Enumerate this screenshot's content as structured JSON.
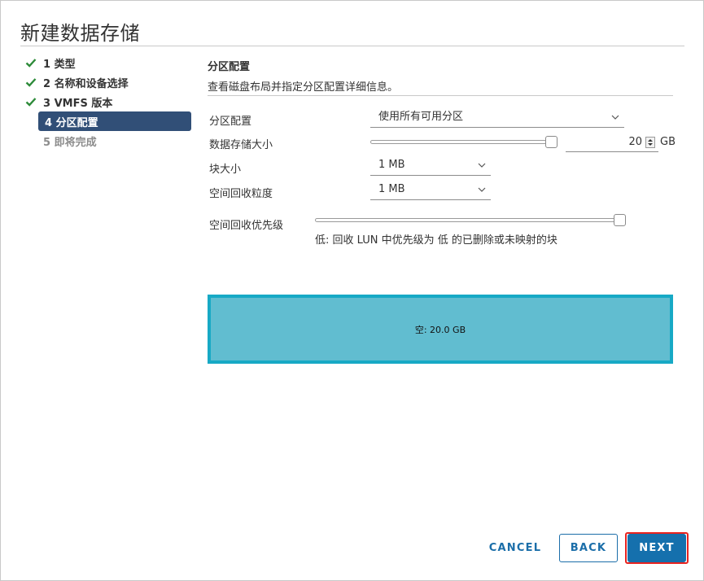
{
  "dialog": {
    "title": "新建数据存储"
  },
  "steps": [
    {
      "label": "1 类型",
      "state": "done"
    },
    {
      "label": "2 名称和设备选择",
      "state": "done"
    },
    {
      "label": "3 VMFS 版本",
      "state": "done"
    },
    {
      "label": "4 分区配置",
      "state": "active"
    },
    {
      "label": "5 即将完成",
      "state": "pending"
    }
  ],
  "section": {
    "title": "分区配置",
    "description": "查看磁盘布局并指定分区配置详细信息。"
  },
  "form": {
    "partition_config": {
      "label": "分区配置",
      "value": "使用所有可用分区"
    },
    "datastore_size": {
      "label": "数据存储大小",
      "value": "20",
      "unit": "GB",
      "slider_fraction": 1.0
    },
    "block_size": {
      "label": "块大小",
      "value": "1 MB"
    },
    "reclaim_granularity": {
      "label": "空间回收粒度",
      "value": "1 MB"
    },
    "reclaim_priority": {
      "label": "空间回收优先级",
      "slider_fraction": 1.0,
      "hint": "低: 回收 LUN 中优先级为 低 的已删除或未映射的块"
    }
  },
  "partition_layout": {
    "label": "空: 20.0 GB",
    "color": "#61bdd0",
    "border_color": "#17a9c5"
  },
  "buttons": {
    "cancel": "CANCEL",
    "back": "BACK",
    "next": "NEXT"
  },
  "colors": {
    "accent": "#1570ad",
    "active_step": "#314f77",
    "check": "#2e8b3a",
    "highlight": "#e8231f"
  }
}
